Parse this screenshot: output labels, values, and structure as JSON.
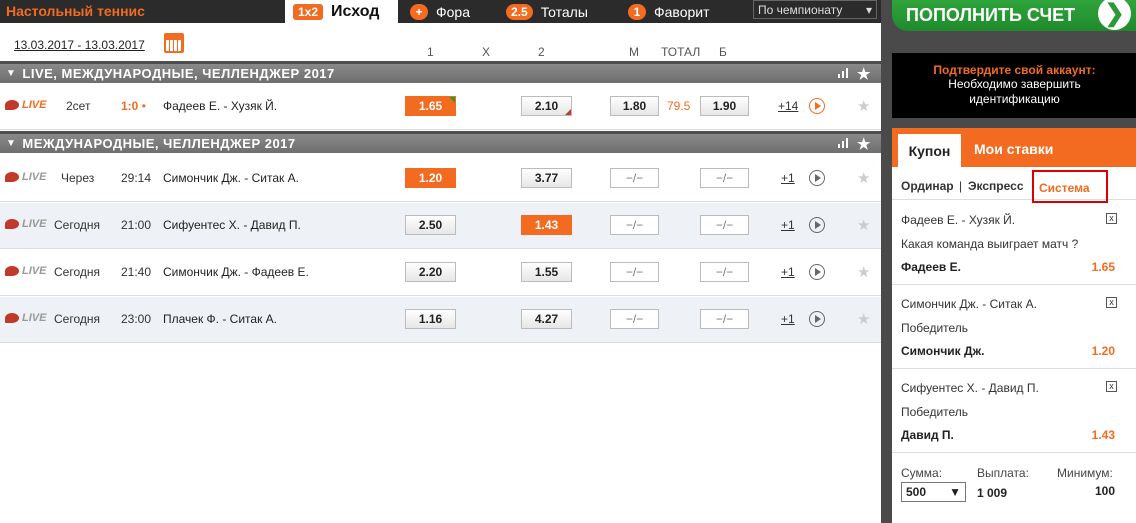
{
  "header": {
    "sport_title": "Настольный теннис",
    "tabs": [
      {
        "badge": "1x2",
        "label": "Исход"
      },
      {
        "badge": "+",
        "label": "Фора"
      },
      {
        "badge": "2.5",
        "label": "Тоталы"
      },
      {
        "badge": "1",
        "label": "Фаворит"
      }
    ],
    "championship_select": "По чемпионату"
  },
  "date_range": "13.03.2017 - 13.03.2017",
  "columns": {
    "c1": "1",
    "cx": "X",
    "c2": "2",
    "m": "М",
    "total": "ТОТАЛ",
    "b": "Б"
  },
  "sections": [
    {
      "title": "LIVE,  МЕЖДУНАРОДНЫЕ, ЧЕЛЛЕНДЖЕР 2017"
    },
    {
      "title": "МЕЖДУНАРОДНЫЕ, ЧЕЛЛЕНДЖЕР 2017"
    }
  ],
  "live_row": {
    "live": "LIVE",
    "state": "2сет",
    "score": "1:0",
    "teams": "Фадеев Е. - Хузяк Й.",
    "odd1": "1.65",
    "odd2": "2.10",
    "m": "1.80",
    "total": "79.5",
    "b": "1.90",
    "more": "+14"
  },
  "rows": [
    {
      "live": "LIVE",
      "state": "Через",
      "time": "29:14",
      "teams": "Симончик Дж. - Ситак А.",
      "odd1": "1.20",
      "odd2": "3.77",
      "m": "−/−",
      "b": "−/−",
      "more": "+1"
    },
    {
      "live": "LIVE",
      "state": "Сегодня",
      "time": "21:00",
      "teams": "Сифуентес Х. - Давид П.",
      "odd1": "2.50",
      "odd2": "1.43",
      "m": "−/−",
      "b": "−/−",
      "more": "+1"
    },
    {
      "live": "LIVE",
      "state": "Сегодня",
      "time": "21:40",
      "teams": "Симончик Дж. - Фадеев Е.",
      "odd1": "2.20",
      "odd2": "1.55",
      "m": "−/−",
      "b": "−/−",
      "more": "+1"
    },
    {
      "live": "LIVE",
      "state": "Сегодня",
      "time": "23:00",
      "teams": "Плачек Ф. - Ситак А.",
      "odd1": "1.16",
      "odd2": "4.27",
      "m": "−/−",
      "b": "−/−",
      "more": "+1"
    }
  ],
  "sidebar": {
    "topup": "ПОПОЛНИТЬ СЧЕТ",
    "confirm_title": "Подтвердите свой аккаунт:",
    "confirm_text1": "Необходимо завершить",
    "confirm_text2": "идентификацию",
    "coupon_tab": "Купон",
    "mybets_tab": "Мои ставки",
    "bet_types": {
      "single": "Ординар",
      "sep": "|",
      "express": "Экспресс",
      "system": "Система"
    },
    "slips": [
      {
        "match": "Фадеев Е. - Хузяк Й.",
        "market": "Какая команда выиграет матч ?",
        "pick": "Фадеев Е.",
        "odd": "1.65"
      },
      {
        "match": "Симончик Дж. - Ситак А.",
        "market": "Победитель",
        "pick": "Симончик Дж.",
        "odd": "1.20"
      },
      {
        "match": "Сифуентес Х. - Давид П.",
        "market": "Победитель",
        "pick": "Давид П.",
        "odd": "1.43"
      }
    ],
    "sum_label": "Сумма:",
    "payout_label": "Выплата:",
    "min_label": "Минимум:",
    "stake": "500",
    "payout": "1 009",
    "minimum": "100"
  },
  "colors": {
    "accent": "#f26b21",
    "green": "#2fa43c",
    "dark": "#2b2b2b"
  }
}
